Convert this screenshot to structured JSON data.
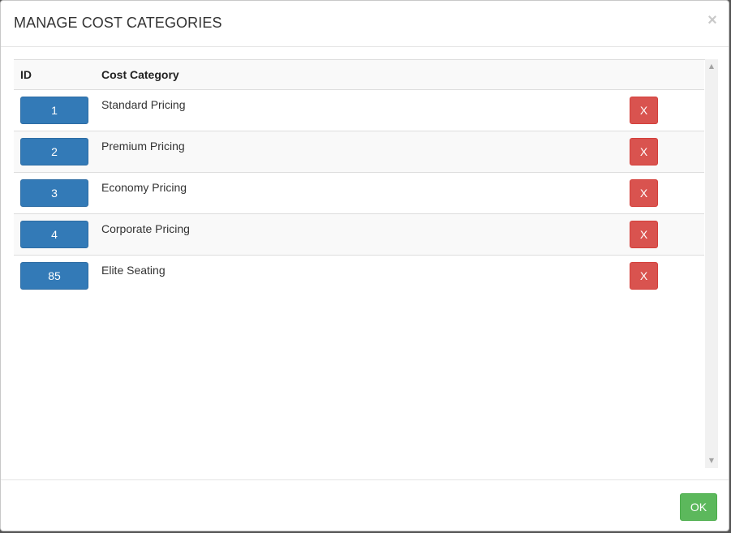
{
  "modal": {
    "title": "MANAGE COST CATEGORIES",
    "close_label": "×"
  },
  "table": {
    "headers": {
      "id": "ID",
      "category": "Cost Category"
    },
    "rows": [
      {
        "id": "1",
        "name": "Standard Pricing",
        "delete_label": "X"
      },
      {
        "id": "2",
        "name": "Premium Pricing",
        "delete_label": "X"
      },
      {
        "id": "3",
        "name": "Economy Pricing",
        "delete_label": "X"
      },
      {
        "id": "4",
        "name": "Corporate Pricing",
        "delete_label": "X"
      },
      {
        "id": "85",
        "name": "Elite Seating",
        "delete_label": "X"
      }
    ]
  },
  "scrollbar": {
    "up_arrow": "▲",
    "down_arrow": "▼"
  },
  "footer": {
    "ok_label": "OK"
  },
  "colors": {
    "primary": "#337ab7",
    "danger": "#d9534f",
    "success": "#5cb85c"
  }
}
